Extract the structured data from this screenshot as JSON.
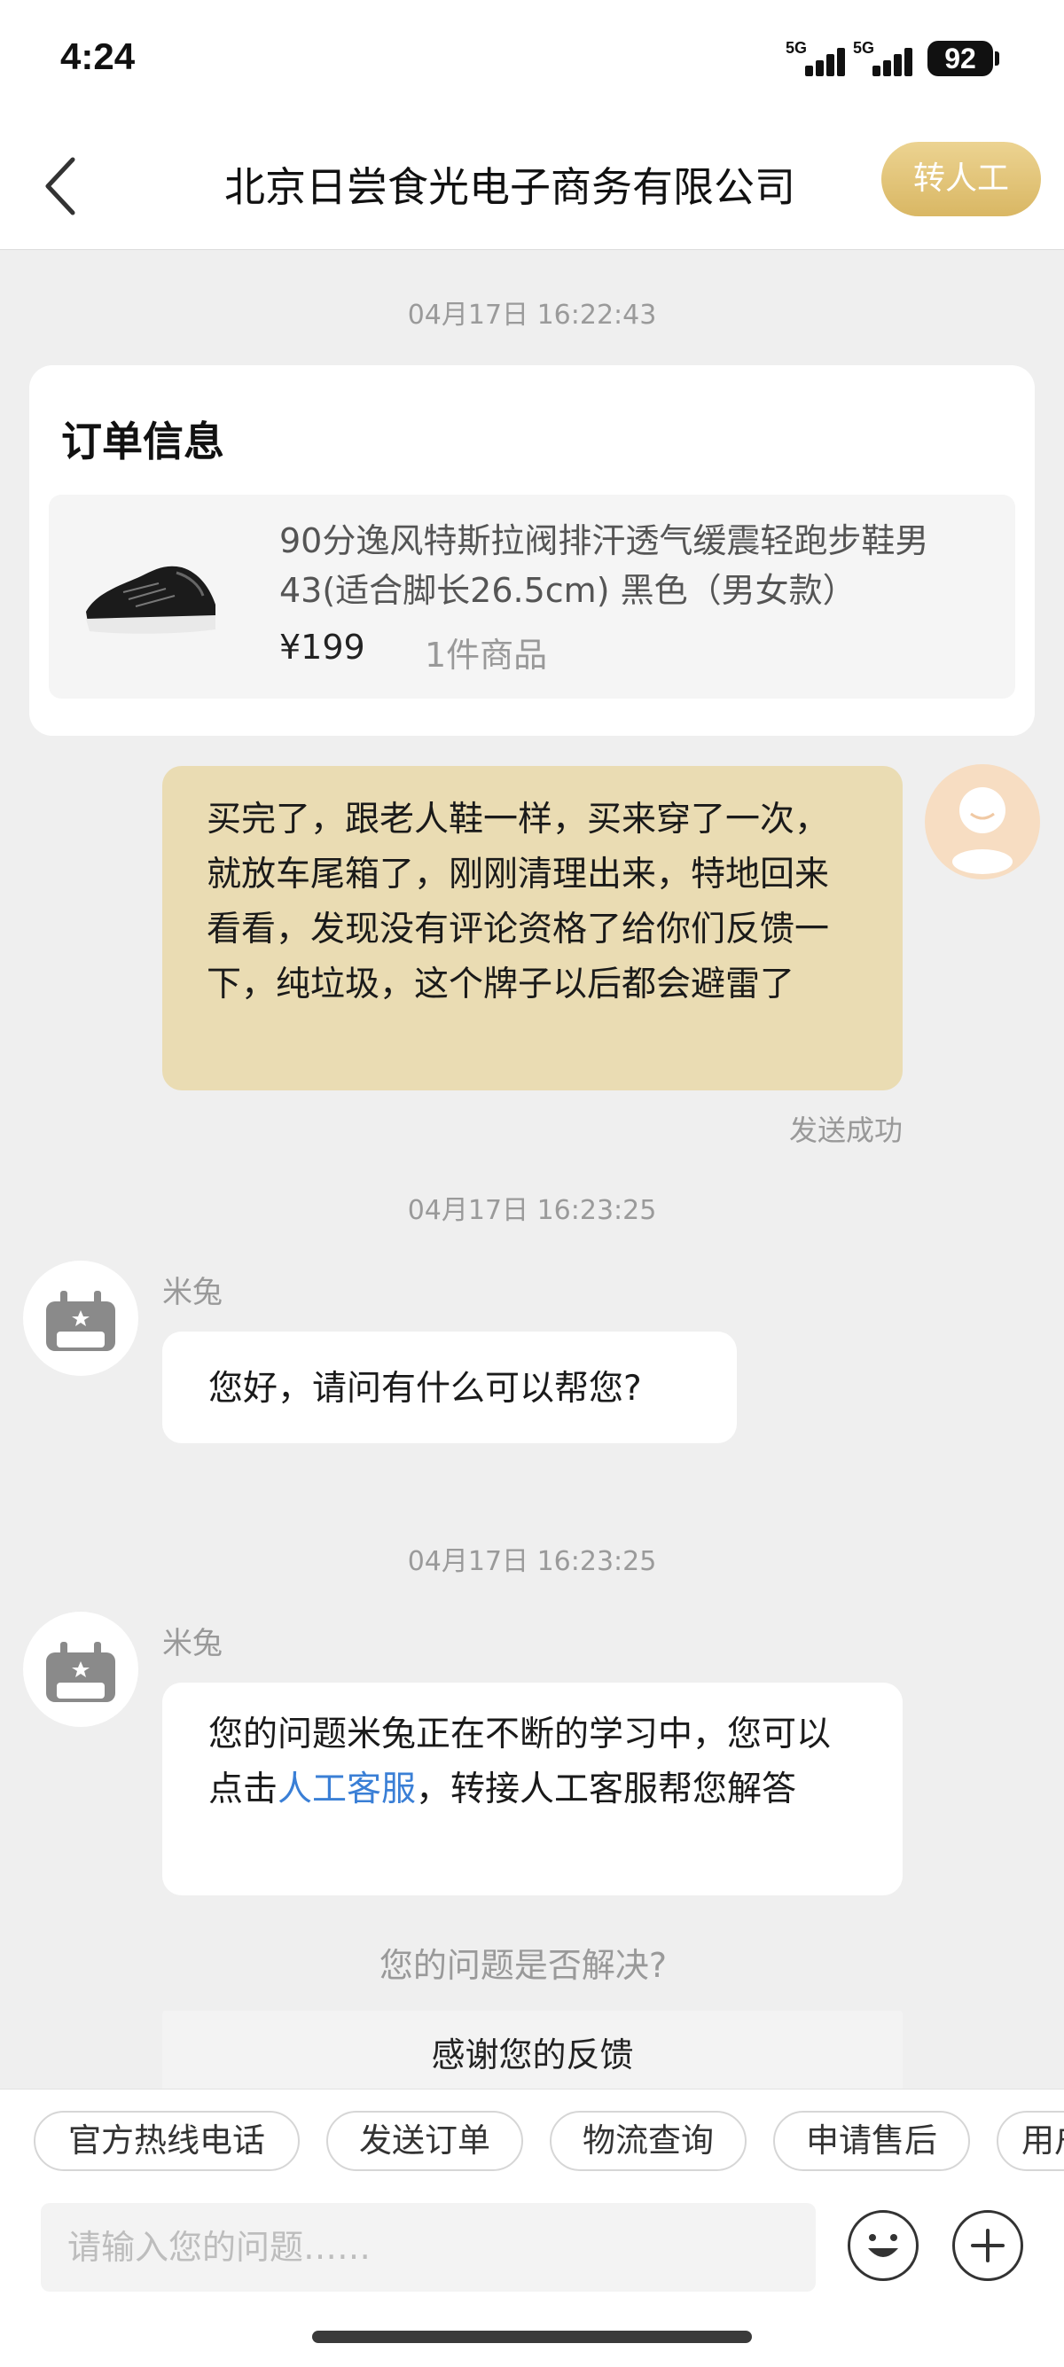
{
  "status_bar": {
    "time": "4:24",
    "network1": "5G",
    "network2": "5G",
    "battery": "92"
  },
  "header": {
    "title": "北京日尝食光电子商务有限公司",
    "transfer_button": "转人工"
  },
  "chat": {
    "time1": "04月17日 16:22:43",
    "order": {
      "title": "订单信息",
      "product_name": "90分逸风特斯拉阀排汗透气缓震轻跑步鞋男 43(适合脚长26.5cm) 黑色（男女款）",
      "price": "¥199",
      "quantity": "1件商品"
    },
    "user_message": "买完了，跟老人鞋一样，买来穿了一次，就放车尾箱了，刚刚清理出来，特地回来看看，发现没有评论资格了给你们反馈一下，纯垃圾，这个牌子以后都会避雷了",
    "send_status": "发送成功",
    "time2": "04月17日 16:23:25",
    "bot1": {
      "name": "米兔",
      "message": "您好，请问有什么可以帮您?"
    },
    "time3": "04月17日 16:23:25",
    "bot2": {
      "name": "米兔",
      "message_prefix": "您的问题米兔正在不断的学习中，您可以点击",
      "message_link": "人工客服",
      "message_suffix": "，转接人工客服帮您解答"
    },
    "resolve_question": "您的问题是否解决?",
    "feedback_button": "感谢您的反馈"
  },
  "quick_actions": [
    "官方热线电话",
    "发送订单",
    "物流查询",
    "申请售后",
    "用户"
  ],
  "input": {
    "placeholder": "请输入您的问题……"
  },
  "icons": {
    "emoji": "smiley-icon",
    "plus": "plus-icon"
  }
}
